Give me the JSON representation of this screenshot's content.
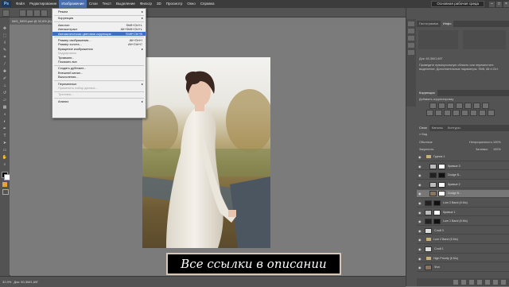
{
  "menubar": {
    "logo": "Ps",
    "items": [
      "Файл",
      "Редактирование",
      "Изображение",
      "Слои",
      "Текст",
      "Выделение",
      "Фильтр",
      "3D",
      "Просмотр",
      "Окно",
      "Справка"
    ],
    "active_index": 2,
    "workspace": "Основная рабочая среда",
    "window_buttons": [
      "–",
      "□",
      "×"
    ]
  },
  "document": {
    "tab_title": "IMG_5993.psd @ 32,6% (Кр"
  },
  "status": {
    "zoom": "32,9%",
    "doc_info": "Док: 60,3M/1,60Г"
  },
  "caption": "Все ссылки в описании",
  "image_menu": {
    "items": [
      {
        "label": "Режим",
        "submenu": true
      },
      {
        "sep": true
      },
      {
        "label": "Коррекция",
        "submenu": true
      },
      {
        "sep": true
      },
      {
        "label": "Автотон",
        "shortcut": "Shift+Ctrl+L"
      },
      {
        "label": "Автоконтраст",
        "shortcut": "Alt+Shift+Ctrl+L"
      },
      {
        "label": "Автоматическая цветовая коррекция",
        "shortcut": "Shift+Ctrl+B",
        "highlighted": true
      },
      {
        "sep": true
      },
      {
        "label": "Размер изображения...",
        "shortcut": "Alt+Ctrl+I"
      },
      {
        "label": "Размер холста...",
        "shortcut": "Alt+Ctrl+C"
      },
      {
        "label": "Вращение изображения",
        "submenu": true
      },
      {
        "label": "Кадрировать",
        "disabled": true
      },
      {
        "label": "Тримминг..."
      },
      {
        "label": "Показать все"
      },
      {
        "sep": true
      },
      {
        "label": "Создать дубликат..."
      },
      {
        "label": "Внешний канал..."
      },
      {
        "label": "Вычисления..."
      },
      {
        "sep": true
      },
      {
        "label": "Переменные",
        "submenu": true
      },
      {
        "label": "Применить набор данных...",
        "disabled": true
      },
      {
        "sep": true
      },
      {
        "label": "Треппинг...",
        "disabled": true
      },
      {
        "sep": true
      },
      {
        "label": "Анализ",
        "submenu": true
      }
    ]
  },
  "histogram_panel": {
    "tabs": [
      "Гистограмма",
      "Инфо"
    ],
    "active_tab": 1,
    "info_text": "Док: 60,3M/1,60Г",
    "hint": "Проведите прямоугольную область или переместите выделение. Дополнительные параметры: Shift, Alt и Ctrl."
  },
  "adjustments_panel": {
    "tab": "Коррекция",
    "title": "Добавить корректировку",
    "icon_rows": [
      7,
      8
    ]
  },
  "layers_panel": {
    "tabs": [
      "Слои",
      "Каналы",
      "Контуры"
    ],
    "active_tab": 0,
    "filter_label": "Вид",
    "blend_mode": "Обычные",
    "opacity_label": "Непрозрачность:",
    "opacity": "100%",
    "lock_label": "Закрепить:",
    "fill_label": "Заливка:",
    "fill": "100%",
    "layers": [
      {
        "name": "Группа 1",
        "type": "group",
        "indent": 0
      },
      {
        "name": "Кривые 3",
        "type": "adjust",
        "indent": 1
      },
      {
        "name": "Dodge B...",
        "type": "mask",
        "indent": 1
      },
      {
        "name": "Кривые 2",
        "type": "adjust",
        "indent": 1
      },
      {
        "name": "Dodge B...",
        "type": "photo",
        "indent": 1,
        "selected": true
      },
      {
        "name": "Lum 2 Band (6 Mo)",
        "type": "mask",
        "indent": 0
      },
      {
        "name": "Кривые 1",
        "type": "adjust",
        "indent": 0
      },
      {
        "name": "Lum 1 Band (6 Mo)",
        "type": "mask",
        "indent": 0
      },
      {
        "name": "Слой 3",
        "type": "blank",
        "indent": 0
      },
      {
        "name": "Lum 2 Band (6 Mo)",
        "type": "group",
        "indent": 0
      },
      {
        "name": "Слой 1",
        "type": "blank",
        "indent": 0
      },
      {
        "name": "High Priority (6 Mo)",
        "type": "group",
        "indent": 0
      },
      {
        "name": "Фон",
        "type": "photo",
        "indent": 0
      }
    ],
    "footer_icons": [
      "link-icon",
      "fx-icon",
      "mask-icon",
      "adjust-icon",
      "folder-icon",
      "new-layer-icon",
      "trash-icon"
    ]
  },
  "colors": {
    "foreground": "#000000",
    "background": "#ffffff",
    "menu_highlight": "#3f6fc2"
  }
}
